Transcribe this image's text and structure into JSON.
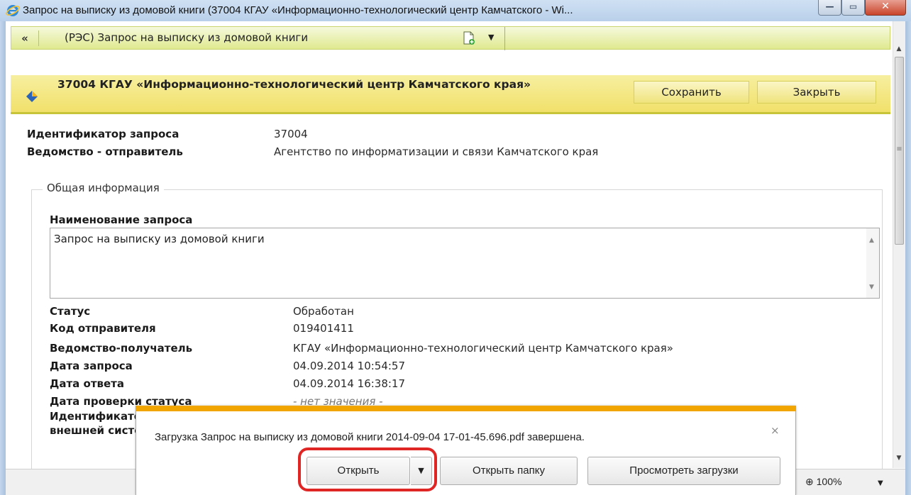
{
  "window": {
    "title": "Запрос на выписку из домовой книги (37004 КГАУ «Информационно-технологический центр Камчатского - Wi...",
    "minimize_glyph": "—",
    "maximize_glyph": "▭",
    "close_glyph": "✕"
  },
  "toolbar": {
    "back_label": "«",
    "document_select": "(РЭС) Запрос на выписку из домовой книги"
  },
  "header": {
    "title": "37004 КГАУ «Информационно-технологический центр Камчатского края»",
    "save_label": "Сохранить",
    "close_label": "Закрыть"
  },
  "request": {
    "id_label": "Идентификатор запроса",
    "id_value": "37004",
    "sender_label": "Ведомство - отправитель",
    "sender_value": "Агентство по информатизации и связи Камчатского края"
  },
  "general": {
    "legend": "Общая информация",
    "name_label": "Наименование запроса",
    "name_value": "Запрос на выписку из домовой книги",
    "fields": [
      {
        "label": "Статус",
        "value": "Обработан"
      },
      {
        "label": "Код отправителя",
        "value": "019401411"
      },
      {
        "label": "Ведомство-получатель",
        "value": "КГАУ «Информационно-технологический центр Камчатского края»"
      },
      {
        "label": "Дата запроса",
        "value": "04.09.2014 10:54:57"
      },
      {
        "label": "Дата ответа",
        "value": "04.09.2014 16:38:17"
      },
      {
        "label": "Дата проверки статуса",
        "value": "- нет значения -"
      },
      {
        "label": "Идентификатор",
        "value": ""
      },
      {
        "label": "внешней системы",
        "value": ""
      }
    ]
  },
  "statusbar": {
    "zoom": "100%"
  },
  "download": {
    "message": "Загрузка Запрос на выписку из домовой книги 2014-09-04 17-01-45.696.pdf завершена.",
    "close_glyph": "×",
    "open_label": "Открыть",
    "open_folder_label": "Открыть папку",
    "view_downloads_label": "Просмотреть загрузки"
  },
  "colors": {
    "toolbar_bg": "#dfe98f",
    "header_bg": "#f1e06a",
    "notif_border": "#f0a500",
    "highlight": "#e02525"
  }
}
